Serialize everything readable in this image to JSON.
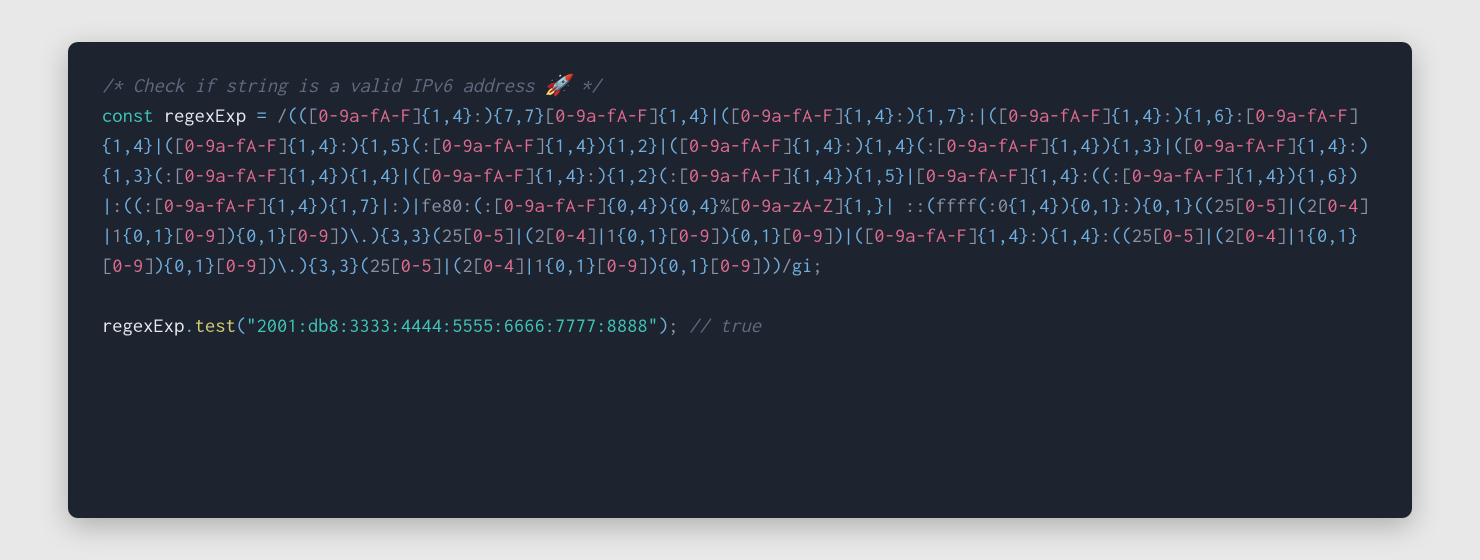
{
  "code": {
    "comment_text": "/* Check if string is a valid IPv6 address 🚀 */",
    "keyword_const": "const",
    "variable_name": "regexExp",
    "equals": " = ",
    "regex_pattern": "(([0-9a-fA-F]{1,4}:){7,7}[0-9a-fA-F]{1,4}|([0-9a-fA-F]{1,4}:){1,7}:|([0-9a-fA-F]{1,4}:){1,6}:[0-9a-fA-F]{1,4}|([0-9a-fA-F]{1,4}:){1,5}(:[0-9a-fA-F]{1,4}){1,2}|([0-9a-fA-F]{1,4}:){1,4}(:[0-9a-fA-F]{1,4}){1,3}|([0-9a-fA-F]{1,4}:){1,3}(:[0-9a-fA-F]{1,4}){1,4}|([0-9a-fA-F]{1,4}:){1,2}(:[0-9a-fA-F]{1,4}){1,5}|[0-9a-fA-F]{1,4}:((:[0-9a-fA-F]{1,4}){1,6})|:((:[0-9a-fA-F]{1,4}){1,7}|:)|fe80:(:[0-9a-fA-F]{0,4}){0,4}%[0-9a-zA-Z]{1,}| ::(ffff(:0{1,4}){0,1}:){0,1}((25[0-5]|(2[0-4]|1{0,1}[0-9]){0,1}[0-9])\\.){3,3}(25[0-5]|(2[0-4]|1{0,1}[0-9]){0,1}[0-9])|([0-9a-fA-F]{1,4}:){1,4}:((25[0-5]|(2[0-4]|1{0,1}[0-9]){0,1}[0-9])\\.){3,3}(25[0-5]|(2[0-4]|1{0,1}[0-9]){0,1}[0-9]))",
    "regex_flags": "gi",
    "semicolon": ";",
    "test_call_object": "regexExp",
    "test_call_dot": ".",
    "test_call_method": "test",
    "test_call_open": "(",
    "test_call_arg": "\"2001:db8:3333:4444:5555:6666:7777:8888\"",
    "test_call_close": ")",
    "test_call_end": ";",
    "result_comment": " // true"
  }
}
